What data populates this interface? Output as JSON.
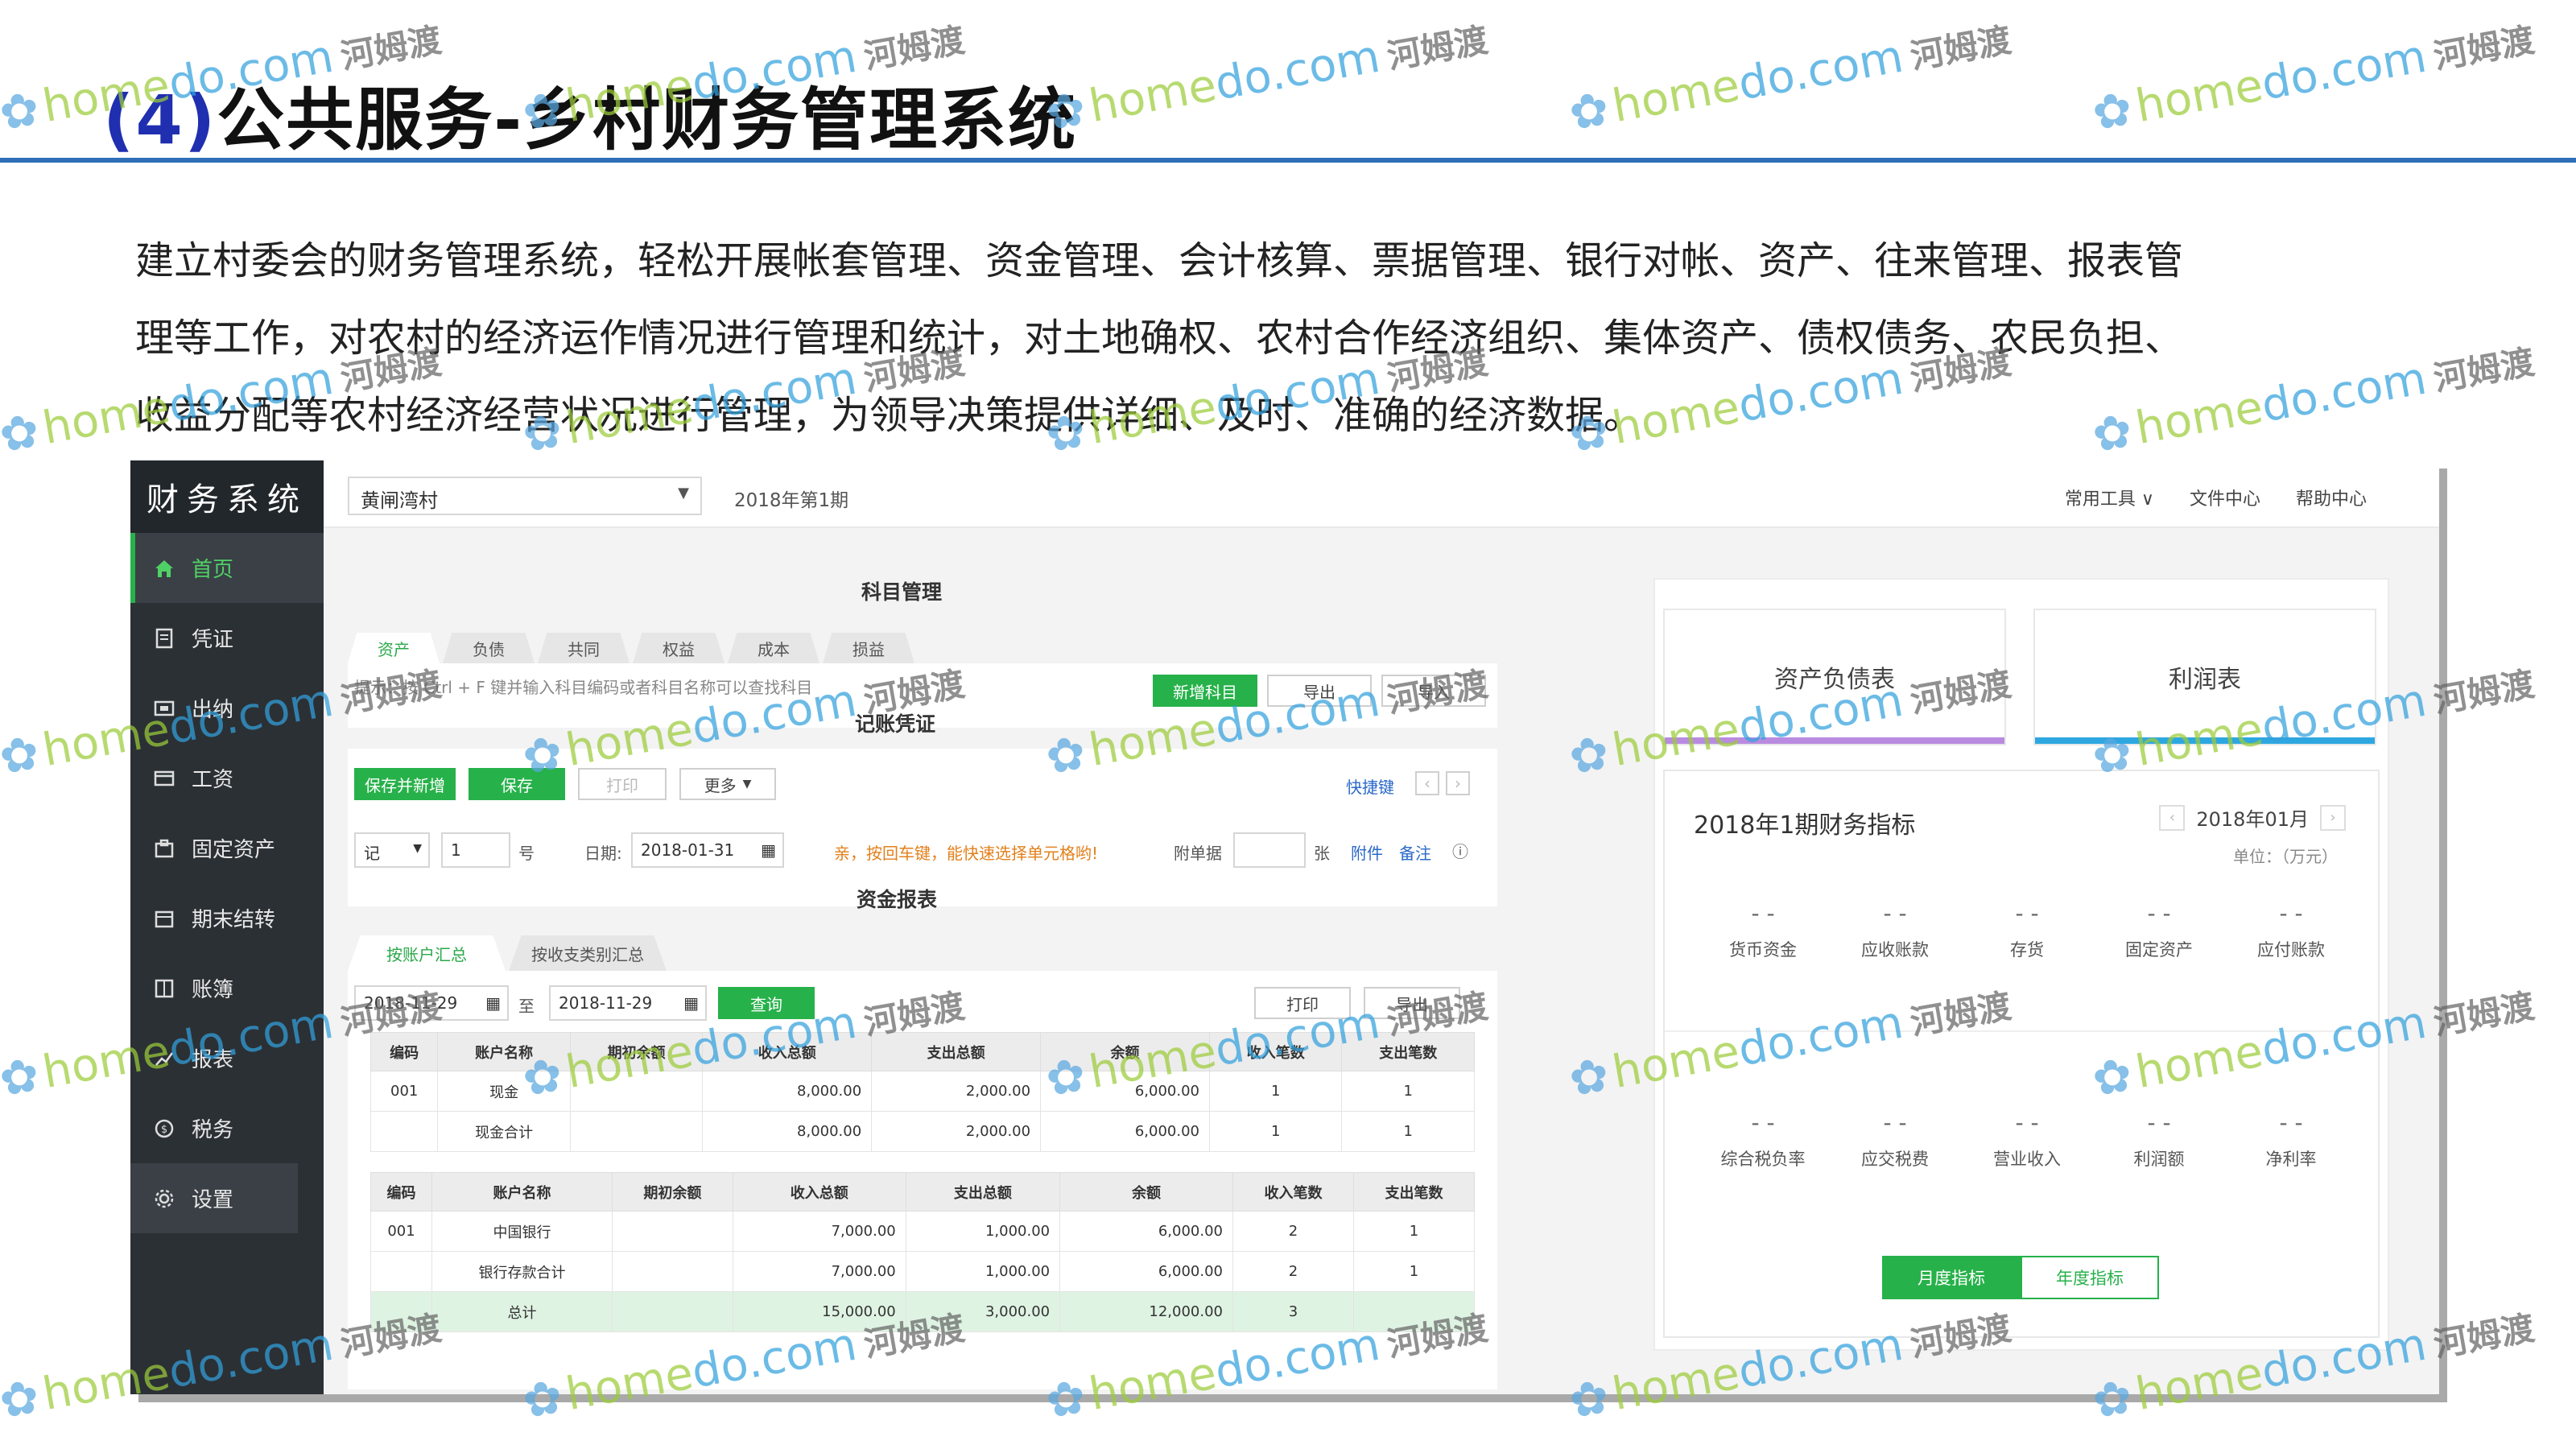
{
  "slide": {
    "title_num": "(4)",
    "title_text": "公共服务-乡村财务管理系统",
    "intro_lines": [
      "建立村委会的财务管理系统，轻松开展帐套管理、资金管理、会计核算、票据管理、银行对帐、资产、往来管理、报表管",
      "理等工作，对农村的经济运作情况进行管理和统计，对土地确权、农村合作经济组织、集体资产、债权债务、农民负担、",
      "收益分配等农村经济经营状况进行管理，为领导决策提供详细、及时、准确的经济数据。"
    ]
  },
  "watermark": {
    "part1": "home",
    "part2": "do.com",
    "cn": "河姆渡"
  },
  "app": {
    "brand": "财务系统",
    "nav": [
      {
        "label": "首页",
        "icon": "home-icon"
      },
      {
        "label": "凭证",
        "icon": "voucher-icon"
      },
      {
        "label": "出纳",
        "icon": "cashier-icon"
      },
      {
        "label": "工资",
        "icon": "salary-icon"
      },
      {
        "label": "固定资产",
        "icon": "asset-icon"
      },
      {
        "label": "期末结转",
        "icon": "calendar-icon"
      },
      {
        "label": "账簿",
        "icon": "ledger-icon"
      },
      {
        "label": "报表",
        "icon": "report-icon"
      },
      {
        "label": "税务",
        "icon": "tax-icon"
      },
      {
        "label": "设置",
        "icon": "gear-icon"
      }
    ],
    "topbar": {
      "village": "黄闸湾村",
      "period": "2018年第1期",
      "links": [
        "常用工具 ∨",
        "文件中心",
        "帮助中心"
      ]
    },
    "subjects": {
      "heading": "科目管理",
      "tabs": [
        "资产",
        "负债",
        "共同",
        "权益",
        "成本",
        "损益"
      ],
      "hint": "提示：按 Ctrl + F 键并输入科目编码或者科目名称可以查找科目",
      "btn_new": "新增科目",
      "btn_export": "导出",
      "btn_import": "导入"
    },
    "voucher": {
      "heading": "记账凭证",
      "btn_save_new": "保存并新增",
      "btn_save": "保存",
      "btn_print": "打印",
      "btn_more": "更多",
      "shortcut": "快捷键",
      "type": "记",
      "number": "1",
      "num_suffix": "号",
      "date_label": "日期:",
      "date": "2018-01-31",
      "warning": "亲，按回车键，能快速选择单元格哟!",
      "attach_label": "附单据",
      "attach_unit": "张",
      "attach_link": "附件",
      "note_link": "备注"
    },
    "funds": {
      "heading": "资金报表",
      "tabs": [
        "按账户汇总",
        "按收支类别汇总"
      ],
      "date_from": "2018-11-29",
      "to": "至",
      "date_to": "2018-11-29",
      "btn_query": "查询",
      "btn_print": "打印",
      "btn_export": "导出",
      "headers": [
        "编码",
        "账户名称",
        "期初余额",
        "收入总额",
        "支出总额",
        "余额",
        "收入笔数",
        "支出笔数"
      ],
      "cash_rows": [
        [
          "001",
          "现金",
          "",
          "8,000.00",
          "2,000.00",
          "6,000.00",
          "1",
          "1"
        ],
        [
          "",
          "现金合计",
          "",
          "8,000.00",
          "2,000.00",
          "6,000.00",
          "1",
          "1"
        ]
      ],
      "bank_rows": [
        [
          "001",
          "中国银行",
          "",
          "7,000.00",
          "1,000.00",
          "6,000.00",
          "2",
          "1"
        ],
        [
          "",
          "银行存款合计",
          "",
          "7,000.00",
          "1,000.00",
          "6,000.00",
          "2",
          "1"
        ]
      ],
      "total_row": [
        "",
        "总计",
        "",
        "15,000.00",
        "3,000.00",
        "12,000.00",
        "3",
        ""
      ]
    },
    "dashboard": {
      "card1": "资产负债表",
      "card2": "利润表",
      "card1_color": "#b98be0",
      "card2_color": "#2ea7e0",
      "title": "2018年1期财务指标",
      "month": "2018年01月",
      "unit": "单位：（万元）",
      "row1": [
        {
          "val": "- -",
          "name": "货币资金"
        },
        {
          "val": "- -",
          "name": "应收账款"
        },
        {
          "val": "- -",
          "name": "存货"
        },
        {
          "val": "- -",
          "name": "固定资产"
        },
        {
          "val": "- -",
          "name": "应付账款"
        }
      ],
      "row2": [
        {
          "val": "- -",
          "name": "综合税负率"
        },
        {
          "val": "- -",
          "name": "应交税费"
        },
        {
          "val": "- -",
          "name": "营业收入"
        },
        {
          "val": "- -",
          "name": "利润额"
        },
        {
          "val": "- -",
          "name": "净利率"
        }
      ],
      "toggle_on": "月度指标",
      "toggle_off": "年度指标"
    }
  }
}
